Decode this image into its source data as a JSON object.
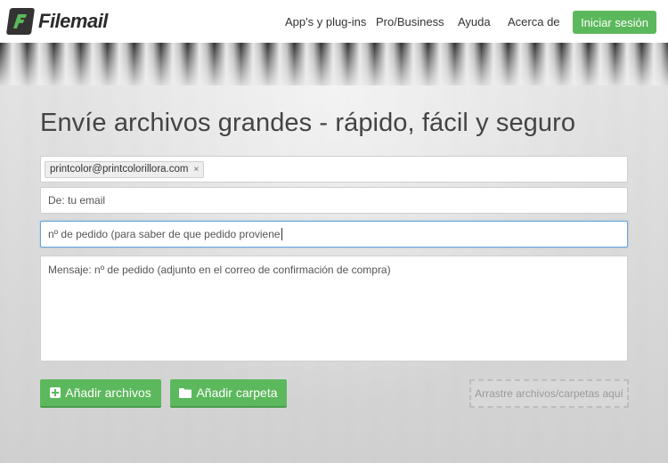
{
  "brand": {
    "name": "Filemail",
    "accent": "#5cb85c"
  },
  "nav": {
    "items": [
      {
        "label": "App's y plug-ins"
      },
      {
        "label": "Pro/Business"
      },
      {
        "label": "Ayuda"
      },
      {
        "label": "Acerca de"
      }
    ],
    "login_label": "Iniciar sesión"
  },
  "main": {
    "headline": "Envíe archivos grandes - rápido, fácil y seguro",
    "recipient_tag": "printcolor@printcolorillora.com",
    "tag_remove_icon": "×",
    "from_placeholder": "De: tu email",
    "subject_value": "nº de pedido (para saber de que pedido proviene",
    "message_placeholder": "Mensaje: nº de pedido (adjunto en el correo de confirmación de compra)",
    "add_files_label": "Añadir archivos",
    "add_folder_label": "Añadir carpeta",
    "drop_zone_label": "Arrastre archivos/carpetas aquí"
  }
}
